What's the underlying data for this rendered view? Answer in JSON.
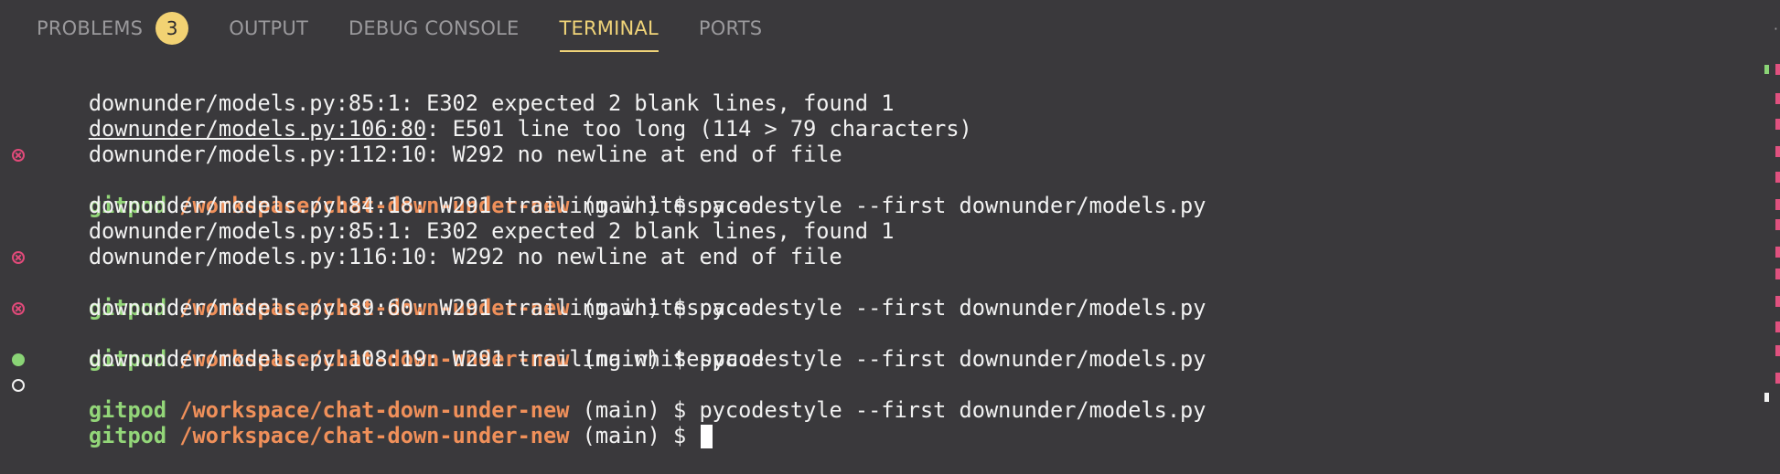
{
  "tabs": [
    {
      "label": "PROBLEMS",
      "badge": "3"
    },
    {
      "label": "OUTPUT"
    },
    {
      "label": "DEBUG CONSOLE"
    },
    {
      "label": "TERMINAL"
    },
    {
      "label": "PORTS"
    }
  ],
  "active_tab": "TERMINAL",
  "colors": {
    "background": "#3a393c",
    "active_tab": "#f0d479",
    "badge": "#f2d273",
    "prompt_user": "#93d679",
    "prompt_path": "#f0905a",
    "error_marker": "#e24a7a",
    "success_marker": "#8ad476",
    "text": "#f2f2f2"
  },
  "terminal": {
    "prompt": {
      "user": "gitpod",
      "path": "/workspace/chat-down-under-new",
      "rest": " (main) $ "
    },
    "lines": {
      "l1": "downunder/models.py:85:1: E302 expected 2 blank lines, found 1",
      "l2_link": "downunder/models.py:106:80",
      "l2_rest": ": E501 line too long (114 > 79 characters)",
      "l3": "downunder/models.py:112:10: W292 no newline at end of file",
      "l4_cmd": "pycodestyle --first downunder/models.py",
      "l5": "downunder/models.py:84:18: W291 trailing whitespace",
      "l6": "downunder/models.py:85:1: E302 expected 2 blank lines, found 1",
      "l7": "downunder/models.py:116:10: W292 no newline at end of file",
      "l8_cmd": "pycodestyle --first downunder/models.py",
      "l9": "downunder/models.py:89:60: W291 trailing whitespace",
      "l10_cmd": "pycodestyle --first downunder/models.py",
      "l11": "downunder/models.py:108:19: W291 trailing whitespace",
      "l12_cmd": "pycodestyle --first downunder/models.py",
      "l13_cmd": ""
    }
  }
}
